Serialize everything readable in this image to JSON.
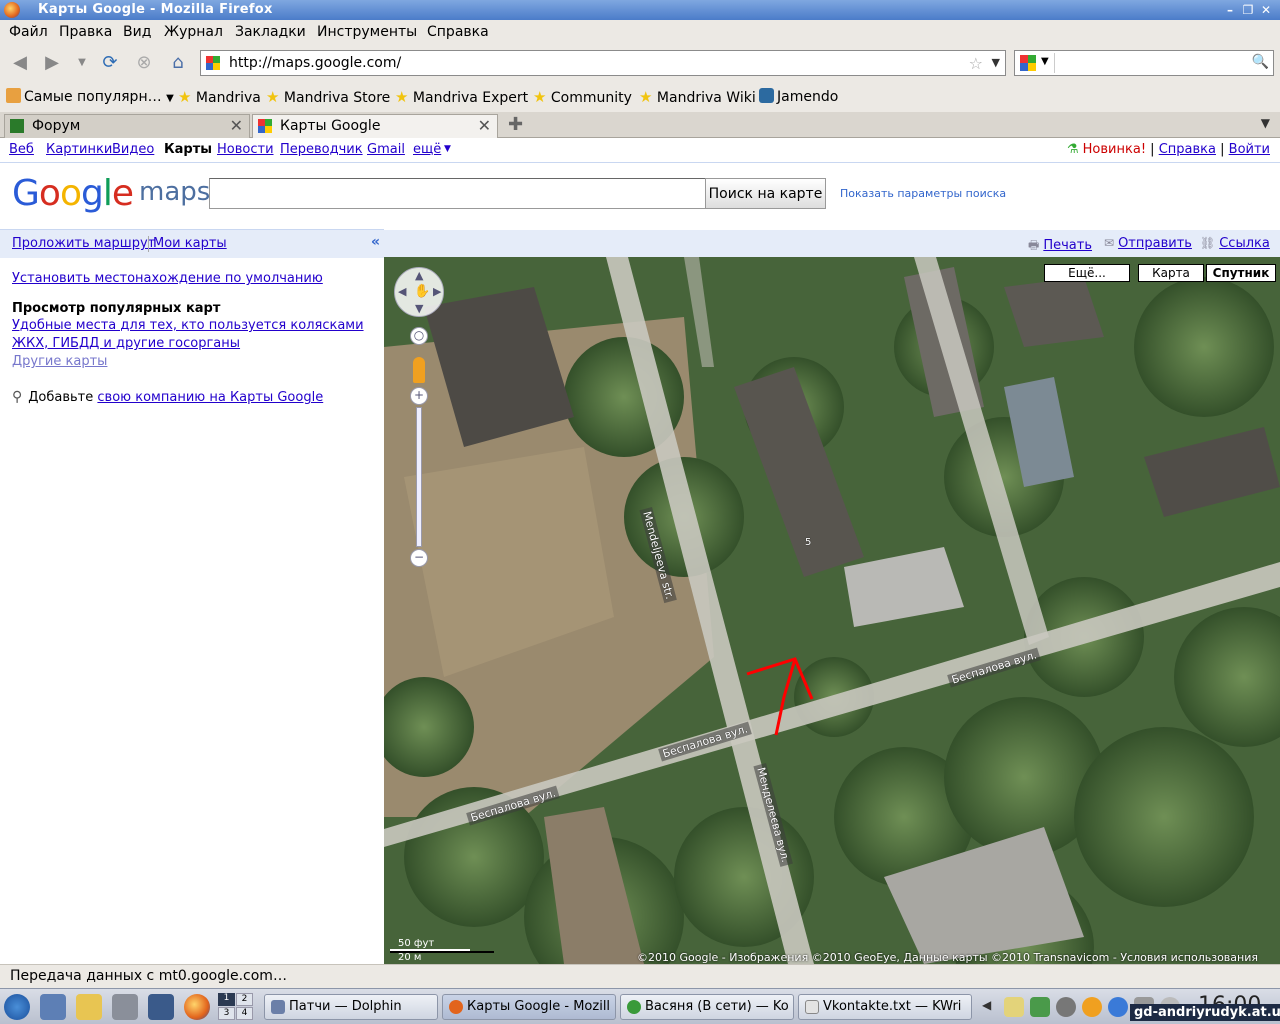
{
  "window": {
    "title": "Карты Google - Mozilla Firefox"
  },
  "menu": [
    "Файл",
    "Правка",
    "Вид",
    "Журнал",
    "Закладки",
    "Инструменты",
    "Справка"
  ],
  "urlbar": {
    "url": "http://maps.google.com/"
  },
  "bookmarks": [
    "Самые популярн…",
    "Mandriva",
    "Mandriva Store",
    "Mandriva Expert",
    "Community",
    "Mandriva Wiki",
    "Jamendo"
  ],
  "tabs": [
    {
      "label": "Форум",
      "active": false
    },
    {
      "label": "Карты Google",
      "active": true
    }
  ],
  "gbar": {
    "links": [
      "Веб",
      "Картинки",
      "Видео"
    ],
    "current": "Карты",
    "links2": [
      "Новости",
      "Переводчик",
      "Gmail",
      "ещё"
    ],
    "more_arrow": "▼",
    "new_label": "Новинка!",
    "help": "Справка",
    "signin": "Войти",
    "separator": "|"
  },
  "logo": {
    "google": "Google",
    "maps": "maps"
  },
  "search": {
    "value": "",
    "button": "Поиск на карте",
    "options": "Показать параметры поиска"
  },
  "left_panel": {
    "directions": "Проложить маршрут",
    "my_maps": "Мои карты",
    "collapse": "«",
    "set_default_location": "Установить местонахождение по умолчанию",
    "popular_heading": "Просмотр популярных карт",
    "popular_links": [
      "Удобные места для тех, кто пользуется колясками",
      "ЖКХ, ГИБДД и другие госорганы",
      "Другие карты"
    ],
    "add_business_prefix": "Добавьте",
    "add_business_link": "свою компанию на Карты Google"
  },
  "map_actions": {
    "print": "Печать",
    "send": "Отправить",
    "link": "Ссылка"
  },
  "map_types": {
    "more": "Ещё...",
    "map": "Карта",
    "satellite": "Спутник",
    "selected": "satellite"
  },
  "street_labels": [
    "Mendeljeeva str.",
    "Беспалова вул.",
    "Беспалова вул.",
    "Беспалова вул.",
    "Менделеєва вул."
  ],
  "building_number": "5",
  "scale": {
    "feet": "50 фут",
    "meters": "20 м"
  },
  "copyright": "©2010 Google - Изображения ©2010 GeoEye, Данные карты ©2010 Transnavicom - Условия использования",
  "status": "Передача данных с mt0.google.com…",
  "taskbar": {
    "tasks": [
      {
        "label": "Патчи — Dolphin",
        "active": false
      },
      {
        "label": "Карты Google - Mozill",
        "active": true
      },
      {
        "label": "Васяня (В сети) — Ko",
        "active": false
      },
      {
        "label": "Vkontakte.txt — KWri",
        "active": false
      }
    ],
    "desktops": [
      "1",
      "2",
      "3",
      "4"
    ],
    "clock": "16:00"
  },
  "watermark": "gd-andriyrudyk.at.ua",
  "colors": {
    "link": "#2200cc",
    "accent_bar": "#e5ecf9",
    "route_line": "#ff0000"
  }
}
